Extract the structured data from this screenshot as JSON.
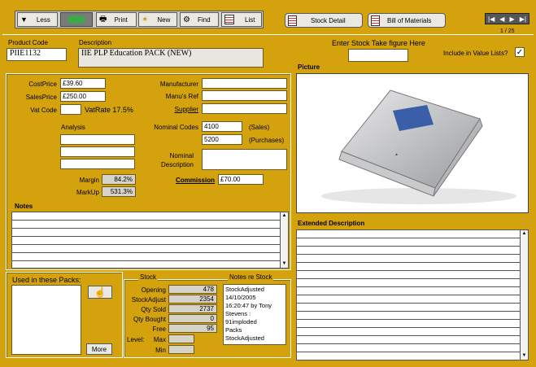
{
  "toolbar": {
    "less": "Less",
    "print": "Print",
    "new": "New",
    "find": "Find",
    "list": "List",
    "stock_detail": "Stock Detail",
    "bill_of_materials": "Bill of Materials",
    "record_position": "1 / 25"
  },
  "header": {
    "product_code_label": "Product Code",
    "product_code": "PIIE1132",
    "description_label": "Description",
    "description": "IIE PLP Education PACK (NEW)",
    "stock_take_label": "Enter Stock Take figure Here",
    "stock_take_value": "",
    "include_label": "Include in Value Lists?",
    "include_checked": "✓"
  },
  "pricing": {
    "cost_label": "CostPrice",
    "cost": "£39.60",
    "sales_label": "SalesPrice",
    "sales": "£250.00",
    "vat_label": "Vat Code",
    "vat_code": "",
    "vat_rate": "VatRate 17.5%",
    "analysis_label": "Analysis",
    "margin_label": "Margin",
    "margin": "84.2%",
    "markup_label": "MarkUp",
    "markup": "531.3%"
  },
  "supplier": {
    "manufacturer_label": "Manufacturer",
    "manus_ref_label": "Manu's Ref",
    "supplier_label": "Supplier",
    "nominal_codes_label": "Nominal Codes",
    "nominal_sales": "4100",
    "sales_tag": "(Sales)",
    "nominal_purchases": "5200",
    "purchases_tag": "(Purchases)",
    "nominal_desc_label1": "Nominal",
    "nominal_desc_label2": "Description",
    "commission_label": "Commission",
    "commission": "£70.00"
  },
  "notes_label": "Notes",
  "picture_label": "Picture",
  "extended_label": "Extended Description",
  "packs": {
    "label": "Used in these Packs:",
    "more": "More"
  },
  "stock": {
    "label": "Stock",
    "opening_label": "Opening",
    "opening": "478",
    "adjust_label": "StockAdjust",
    "adjust": "2354",
    "sold_label": "Qty Sold",
    "sold": "2737",
    "bought_label": "Qty Bought",
    "bought": "0",
    "free_label": "Free",
    "free": "95",
    "level_label": "Level:",
    "max_label": "Max",
    "min_label": "Min"
  },
  "notes_re_stock": {
    "label": "Notes re Stock",
    "lines": [
      "StockAdjusted",
      "14/10/2005",
      "16:20:47 by Tony",
      "Stevens :",
      "91imploded",
      "Packs",
      "StockAdjusted"
    ]
  },
  "colors": {
    "background": "#d4a20c",
    "field": "#ffffff",
    "readonly": "#d6d3c8"
  }
}
